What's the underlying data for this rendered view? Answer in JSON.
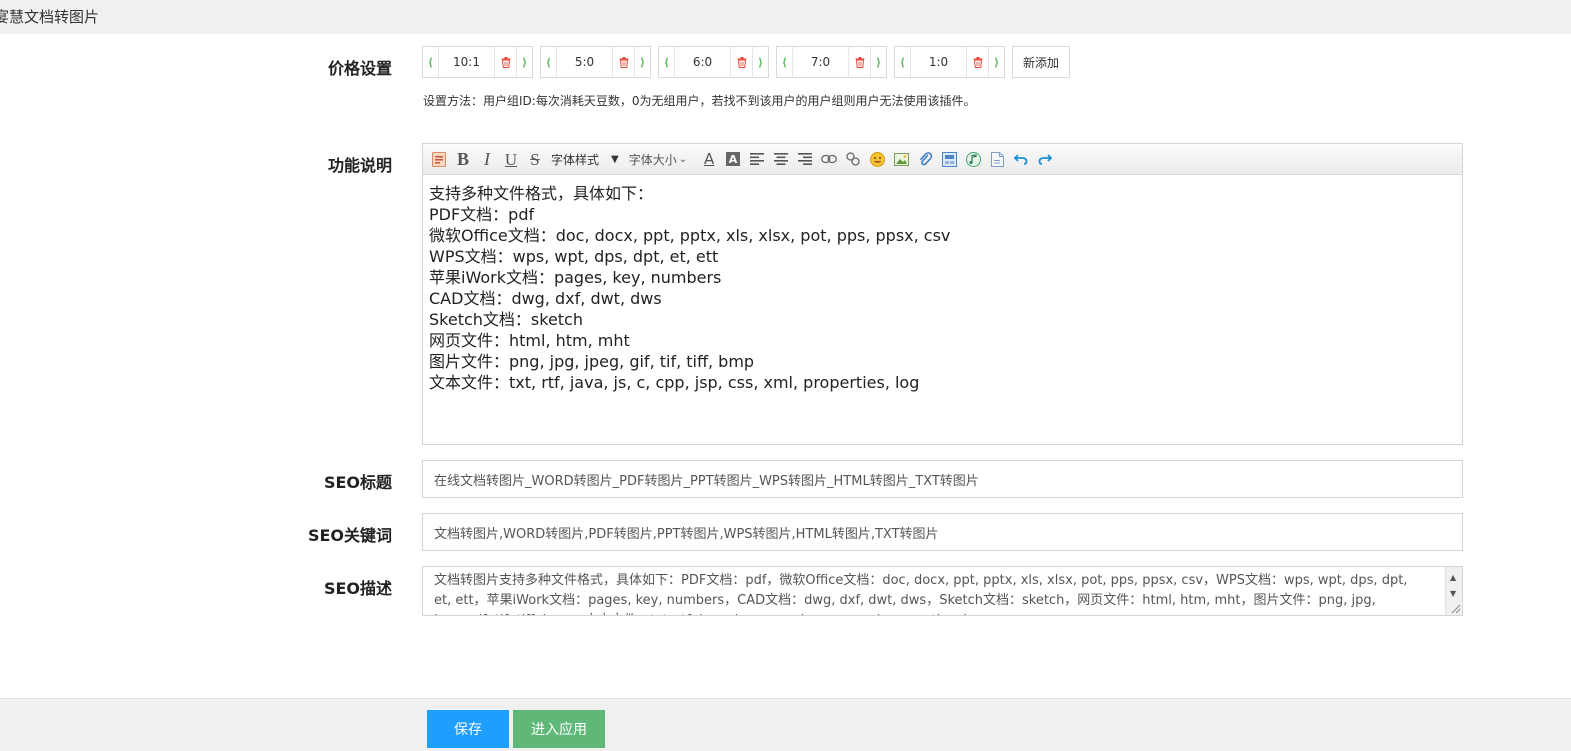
{
  "window": {
    "title": "宴慧文档转图片"
  },
  "price": {
    "label": "价格设置",
    "groups": [
      {
        "value": "10:1"
      },
      {
        "value": "5:0"
      },
      {
        "value": "6:0"
      },
      {
        "value": "7:0"
      },
      {
        "value": "1:0"
      }
    ],
    "arrow_left": "⟨",
    "arrow_right": "⟩",
    "add_label": "新添加",
    "hint": "设置方法：用户组ID:每次消耗天豆数，0为无组用户，若找不到该用户的用户组则用户无法使用该插件。"
  },
  "description": {
    "label": "功能说明",
    "toolbar": {
      "font_style": "字体样式",
      "font_size": "字体大小",
      "icons": [
        "source-icon",
        "bold-icon",
        "italic-icon",
        "underline-icon",
        "strikethrough-icon",
        "font-color-icon",
        "background-color-icon",
        "align-left-icon",
        "align-center-icon",
        "align-right-icon",
        "link-icon",
        "unlink-icon",
        "emoji-icon",
        "image-icon",
        "attachment-icon",
        "insert-file-icon",
        "music-icon",
        "document-icon",
        "undo-icon",
        "redo-icon"
      ]
    },
    "lines": [
      "支持多种文件格式，具体如下：",
      "PDF文档：pdf",
      "微软Office文档：doc, docx, ppt, pptx, xls, xlsx, pot, pps, ppsx, csv",
      "WPS文档：wps, wpt, dps, dpt, et, ett",
      "苹果iWork文档：pages, key, numbers",
      "CAD文档：dwg, dxf, dwt, dws",
      "Sketch文档：sketch",
      "网页文件：html, htm, mht",
      "图片文件：png, jpg, jpeg, gif, tif, tiff, bmp",
      "文本文件：txt, rtf, java, js, c, cpp, jsp, css, xml, properties, log"
    ]
  },
  "seo": {
    "title_label": "SEO标题",
    "title_value": "在线文档转图片_WORD转图片_PDF转图片_PPT转图片_WPS转图片_HTML转图片_TXT转图片",
    "keywords_label": "SEO关键词",
    "keywords_value": "文档转图片,WORD转图片,PDF转图片,PPT转图片,WPS转图片,HTML转图片,TXT转图片",
    "desc_label": "SEO描述",
    "desc_value": "文档转图片支持多种文件格式，具体如下：PDF文档：pdf，微软Office文档：doc, docx, ppt, pptx, xls, xlsx, pot, pps, ppsx, csv，WPS文档：wps, wpt, dps, dpt, et, ett，苹果iWork文档：pages, key, numbers，CAD文档：dwg, dxf, dwt, dws，Sketch文档：sketch，网页文件：html, htm, mht，图片文件：png, jpg, jpeg, gif, tif, tiff, bmp，文本文件：txt, rtf, java, js, c, cpp, jsp, css, xml, properties, log"
  },
  "footer": {
    "save_label": "保存",
    "enter_label": "进入应用"
  },
  "colors": {
    "save": "#1e9fff",
    "enter": "#5fb878",
    "arrow": "#5cb85c",
    "delete": "#e8483c"
  }
}
